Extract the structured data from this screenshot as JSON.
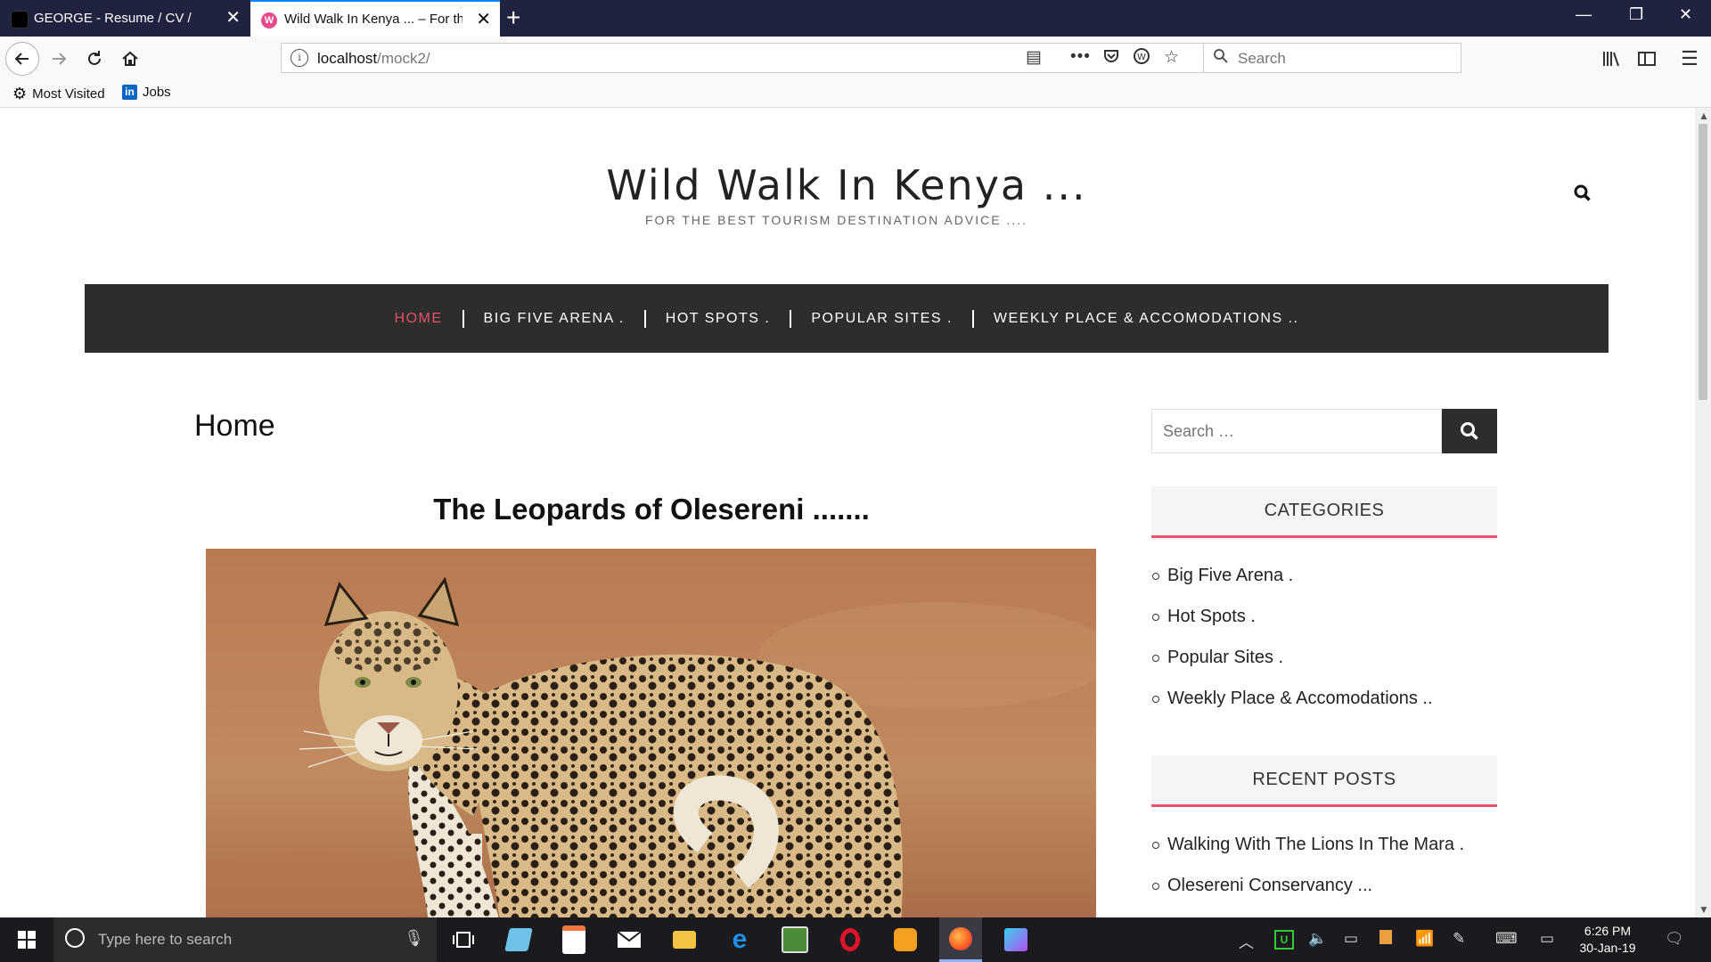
{
  "browser": {
    "tabs": [
      {
        "title": "GEORGE - Resume / CV /",
        "active": false
      },
      {
        "title": "Wild Walk In Kenya ... – For the",
        "active": true
      }
    ],
    "url_host": "localhost",
    "url_path": "/mock2/",
    "search_placeholder": "Search",
    "bookmarks": [
      {
        "label": "Most Visited",
        "icon": "gear-icon"
      },
      {
        "label": "Jobs",
        "icon": "linkedin-icon"
      }
    ]
  },
  "site": {
    "title": "Wild Walk In Kenya ...",
    "tagline": "FOR THE BEST TOURISM DESTINATION ADVICE ....",
    "nav": [
      {
        "label": "HOME",
        "active": true
      },
      {
        "label": "BIG FIVE ARENA .",
        "active": false
      },
      {
        "label": "HOT SPOTS .",
        "active": false
      },
      {
        "label": "POPULAR SITES .",
        "active": false
      },
      {
        "label": "WEEKLY PLACE & ACCOMODATIONS ..",
        "active": false
      }
    ],
    "accent_color": "#e8506c",
    "nav_bg": "#2d2d2d"
  },
  "content": {
    "page_heading": "Home",
    "post_title": "The Leopards of Olesereni ......."
  },
  "sidebar": {
    "search_placeholder": "Search …",
    "categories_title": "CATEGORIES",
    "categories": [
      "Big Five Arena .",
      "Hot Spots .",
      "Popular Sites .",
      "Weekly Place & Accomodations .."
    ],
    "recent_title": "RECENT POSTS",
    "recent_posts": [
      "Walking With The Lions In The Mara .",
      "Olesereni Conservancy ..."
    ]
  },
  "taskbar": {
    "search_placeholder": "Type here to search",
    "time": "6:26 PM",
    "date": "30-Jan-19"
  }
}
